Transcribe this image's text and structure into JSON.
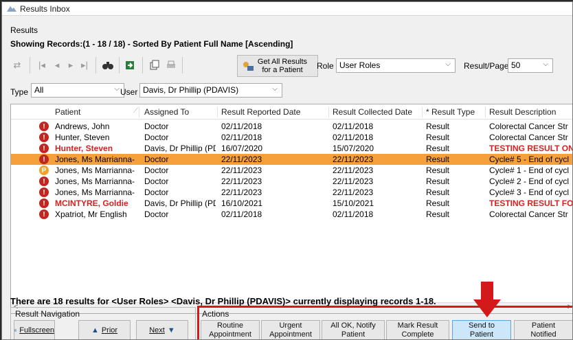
{
  "window": {
    "title": "Results Inbox"
  },
  "section_label": "Results",
  "showing_text": "Showing Records:(1 - 18 / 18) - Sorted By Patient Full Name [Ascending]",
  "toolbar": {
    "get_all_label_line1": "Get All Results",
    "get_all_label_line2": "for a Patient",
    "role_label": "Role",
    "role_value": "User Roles",
    "result_page_label": "Result/Page",
    "result_page_value": "50"
  },
  "filters": {
    "type_label": "Type",
    "type_value": "All",
    "user_label": "User",
    "user_value": "Davis, Dr Phillip (PDAVIS)"
  },
  "table": {
    "headers": [
      "Patient",
      "Assigned To",
      "Result Reported Date",
      "Result Collected Date",
      "* Result Type",
      "Result Description"
    ],
    "rows": [
      {
        "status": "urgent",
        "status_glyph": "!",
        "patient": "Andrews, John",
        "assigned": "Doctor",
        "reported": "02/11/2018",
        "collected": "02/11/2018",
        "type": "Result",
        "desc": "Colorectal Cancer Str",
        "red": false,
        "selected": false
      },
      {
        "status": "urgent",
        "status_glyph": "!",
        "patient": "Hunter, Steven",
        "assigned": "Doctor",
        "reported": "02/11/2018",
        "collected": "02/11/2018",
        "type": "Result",
        "desc": "Colorectal Cancer Str",
        "red": false,
        "selected": false
      },
      {
        "status": "urgent",
        "status_glyph": "!",
        "patient": "Hunter, Steven",
        "assigned": "Davis, Dr Phillip (PDA...",
        "reported": "16/07/2020",
        "collected": "15/07/2020",
        "type": "Result",
        "desc": "TESTING RESULT ONI",
        "red": true,
        "selected": false
      },
      {
        "status": "urgent",
        "status_glyph": "!",
        "patient": "Jones, Ms Marrianna-",
        "assigned": "Doctor",
        "reported": "22/11/2023",
        "collected": "22/11/2023",
        "type": "Result",
        "desc": "Cycle# 5 - End of cycl",
        "red": false,
        "selected": true
      },
      {
        "status": "pending",
        "status_glyph": "P",
        "patient": "Jones, Ms Marrianna-",
        "assigned": "Doctor",
        "reported": "22/11/2023",
        "collected": "22/11/2023",
        "type": "Result",
        "desc": "Cycle# 1 - End of cycl",
        "red": false,
        "selected": false
      },
      {
        "status": "urgent",
        "status_glyph": "!",
        "patient": "Jones, Ms Marrianna-",
        "assigned": "Doctor",
        "reported": "22/11/2023",
        "collected": "22/11/2023",
        "type": "Result",
        "desc": "Cycle# 2 - End of cycl",
        "red": false,
        "selected": false
      },
      {
        "status": "urgent",
        "status_glyph": "!",
        "patient": "Jones, Ms Marrianna-",
        "assigned": "Doctor",
        "reported": "22/11/2023",
        "collected": "22/11/2023",
        "type": "Result",
        "desc": "Cycle# 3 - End of cycl",
        "red": false,
        "selected": false
      },
      {
        "status": "urgent",
        "status_glyph": "!",
        "patient": "MCINTYRE, Goldie",
        "assigned": "Davis, Dr Phillip (PDA...",
        "reported": "16/10/2021",
        "collected": "15/10/2021",
        "type": "Result",
        "desc": "TESTING RESULT FOU",
        "red": true,
        "selected": false
      },
      {
        "status": "urgent",
        "status_glyph": "!",
        "patient": "Xpatriot, Mr English",
        "assigned": "Doctor",
        "reported": "02/11/2018",
        "collected": "02/11/2018",
        "type": "Result",
        "desc": "Colorectal Cancer Str",
        "red": false,
        "selected": false
      }
    ]
  },
  "summary_text": "There are 18 results for <User Roles> <Davis, Dr Phillip (PDAVIS)> currently displaying records 1-18.",
  "navigation": {
    "title": "Result Navigation",
    "fullscreen": "Fullscreen",
    "prior": "Prior",
    "next": "Next"
  },
  "actions": {
    "title": "Actions",
    "buttons": [
      {
        "line1": "Routine",
        "line2": "Appointment"
      },
      {
        "line1": "Urgent",
        "line2": "Appointment"
      },
      {
        "line1": "All OK, Notify",
        "line2": "Patient"
      },
      {
        "line1": "Mark Result",
        "line2": "Complete"
      },
      {
        "line1": "Send to",
        "line2": "Patient"
      },
      {
        "line1": "Patient",
        "line2": "Notified"
      }
    ]
  },
  "colors": {
    "selected_row": "#f6a03c",
    "urgent_status": "#c0261f",
    "pending_status": "#f0a22a",
    "highlight": "#d31919",
    "active_button": "#cce7fa"
  }
}
